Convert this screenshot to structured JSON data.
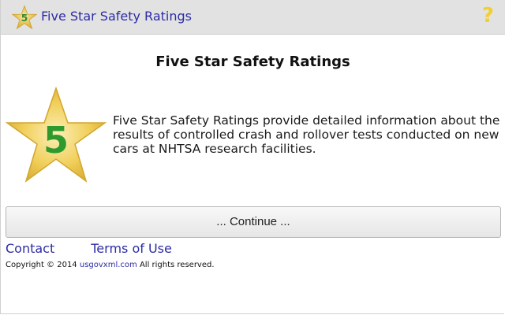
{
  "header": {
    "logo_number": "5",
    "title": "Five Star Safety Ratings",
    "help_icon": "question-mark-icon",
    "help_glyph": "?"
  },
  "main": {
    "title": "Five Star Safety Ratings",
    "star_number": "5",
    "description": "Five Star Safety Ratings provide detailed information about the results of controlled crash and rollover tests conducted on new cars at NHTSA research facilities.",
    "continue_label": "... Continue ..."
  },
  "footer": {
    "contact_label": "Contact",
    "terms_label": "Terms of Use",
    "copyright_prefix": "Copyright © 2014",
    "copyright_link": "usgovxml.com",
    "copyright_suffix": "All rights reserved."
  },
  "colors": {
    "header_bg": "#e2e2e2",
    "link": "#2c2ca8",
    "star_gold": "#e8c23a",
    "star_number": "#2e9a2e",
    "help_icon": "#f2cf2c"
  }
}
